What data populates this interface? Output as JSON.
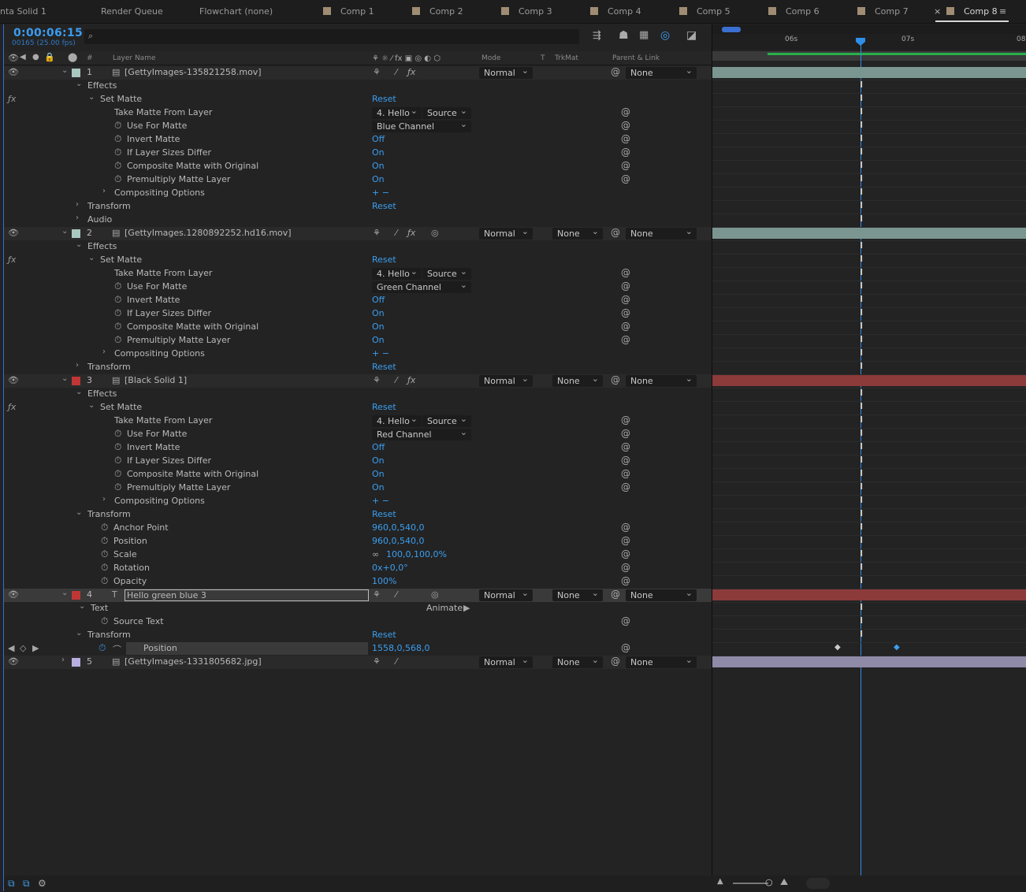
{
  "tabs": [
    {
      "label": "nta Solid 1",
      "swatch": false
    },
    {
      "label": "Render Queue",
      "swatch": false
    },
    {
      "label": "Flowchart (none)",
      "swatch": false
    },
    {
      "label": "Comp 1",
      "swatch": true
    },
    {
      "label": "Comp 2",
      "swatch": true
    },
    {
      "label": "Comp 3",
      "swatch": true
    },
    {
      "label": "Comp 4",
      "swatch": true
    },
    {
      "label": "Comp 5",
      "swatch": true
    },
    {
      "label": "Comp 6",
      "swatch": true
    },
    {
      "label": "Comp 7",
      "swatch": true
    },
    {
      "label": "Comp 8",
      "swatch": true,
      "active": true
    }
  ],
  "timecode": "0:00:06:15",
  "frames": "00165 (25.00 fps)",
  "search_placeholder": "",
  "headers": {
    "layer_name": "Layer Name",
    "mode": "Mode",
    "t": "T",
    "trkmat": "TrkMat",
    "parent": "Parent & Link",
    "num": "#"
  },
  "ruler": {
    "t1": "06s",
    "t2": "07s",
    "t3": "08"
  },
  "strings": {
    "effects": "Effects",
    "set_matte": "Set Matte",
    "reset": "Reset",
    "take": "Take Matte From Layer",
    "use": "Use For Matte",
    "invert": "Invert Matte",
    "differ": "If Layer Sizes Differ",
    "composite": "Composite Matte with Original",
    "premult": "Premultiply Matte Layer",
    "compositing": "Compositing Options",
    "transform": "Transform",
    "audio": "Audio",
    "text": "Text",
    "source_text": "Source Text",
    "animate": "Animate:",
    "anchor": "Anchor Point",
    "position": "Position",
    "scale": "Scale",
    "rotation": "Rotation",
    "opacity": "Opacity",
    "hello": "4. Hello",
    "source": "Source",
    "off": "Off",
    "on": "On",
    "normal": "Normal",
    "none": "None",
    "fx": "fx",
    "plusminus": "+ −"
  },
  "layers": [
    {
      "num": "1",
      "name": "[GettyImages-135821258.mov]",
      "color": "#a8c8c0",
      "matte": "Blue Channel"
    },
    {
      "num": "2",
      "name": "[GettyImages.1280892252.hd16.mov]",
      "color": "#a8c8c0",
      "matte": "Green Channel"
    },
    {
      "num": "3",
      "name": "[Black Solid 1]",
      "color": "#c03636",
      "matte": "Red Channel",
      "anchor": "960,0,540,0",
      "position": "960,0,540,0",
      "scale": "100,0,100,0%",
      "rotation": "0x+0,0°",
      "opacity": "100%"
    },
    {
      "num": "4",
      "name": "Hello green blue 3",
      "color": "#c03636",
      "position": "1558,0,568,0"
    },
    {
      "num": "5",
      "name": "[GettyImages-1331805682.jpg]",
      "color": "#b8aee0"
    }
  ],
  "colors": {
    "accent": "#3b9ef0",
    "bar_teal": "#7b9690",
    "bar_red": "#8c3a3a",
    "bar_lav": "#8f8aa8",
    "green_work": "#28b04a"
  }
}
